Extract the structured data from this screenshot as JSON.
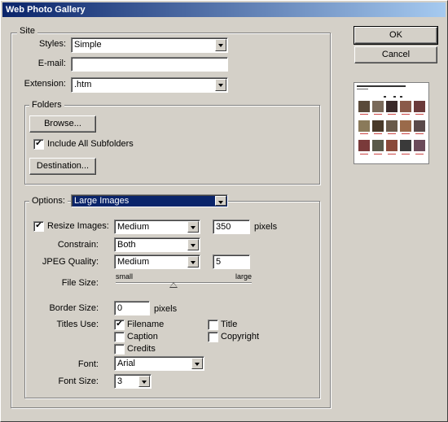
{
  "window": {
    "title": "Web Photo Gallery"
  },
  "buttons": {
    "ok": "OK",
    "cancel": "Cancel"
  },
  "site": {
    "group_title": "Site",
    "styles_label": "Styles:",
    "styles_value": "Simple",
    "email_label": "E-mail:",
    "email_value": "",
    "extension_label": "Extension:",
    "extension_value": ".htm"
  },
  "folders": {
    "group_title": "Folders",
    "browse_label": "Browse...",
    "include_subfolders_label": "Include All Subfolders",
    "include_subfolders_checked": true,
    "destination_label": "Destination..."
  },
  "options": {
    "label": "Options:",
    "value": "Large Images",
    "resize_images_label": "Resize Images:",
    "resize_images_checked": true,
    "resize_size": "Medium",
    "resize_pixels": "350",
    "pixels_unit": "pixels",
    "constrain_label": "Constrain:",
    "constrain_value": "Both",
    "jpeg_quality_label": "JPEG Quality:",
    "jpeg_quality_value": "Medium",
    "jpeg_quality_number": "5",
    "file_size_label": "File Size:",
    "file_size_small": "small",
    "file_size_large": "large",
    "file_size_level": 0.5,
    "border_size_label": "Border Size:",
    "border_size_value": "0",
    "border_unit": "pixels",
    "titles_use_label": "Titles Use:",
    "titles": {
      "filename": {
        "label": "Filename",
        "checked": true
      },
      "caption": {
        "label": "Caption",
        "checked": false
      },
      "credits": {
        "label": "Credits",
        "checked": false
      },
      "title": {
        "label": "Title",
        "checked": false
      },
      "copyright": {
        "label": "Copyright",
        "checked": false
      }
    },
    "font_label": "Font:",
    "font_value": "Arial",
    "font_size_label": "Font Size:",
    "font_size_value": "3"
  },
  "colors": {
    "title_start": "#0a246a",
    "title_end": "#a6caf0",
    "face": "#d4d0c8",
    "highlight": "#0a246a"
  }
}
